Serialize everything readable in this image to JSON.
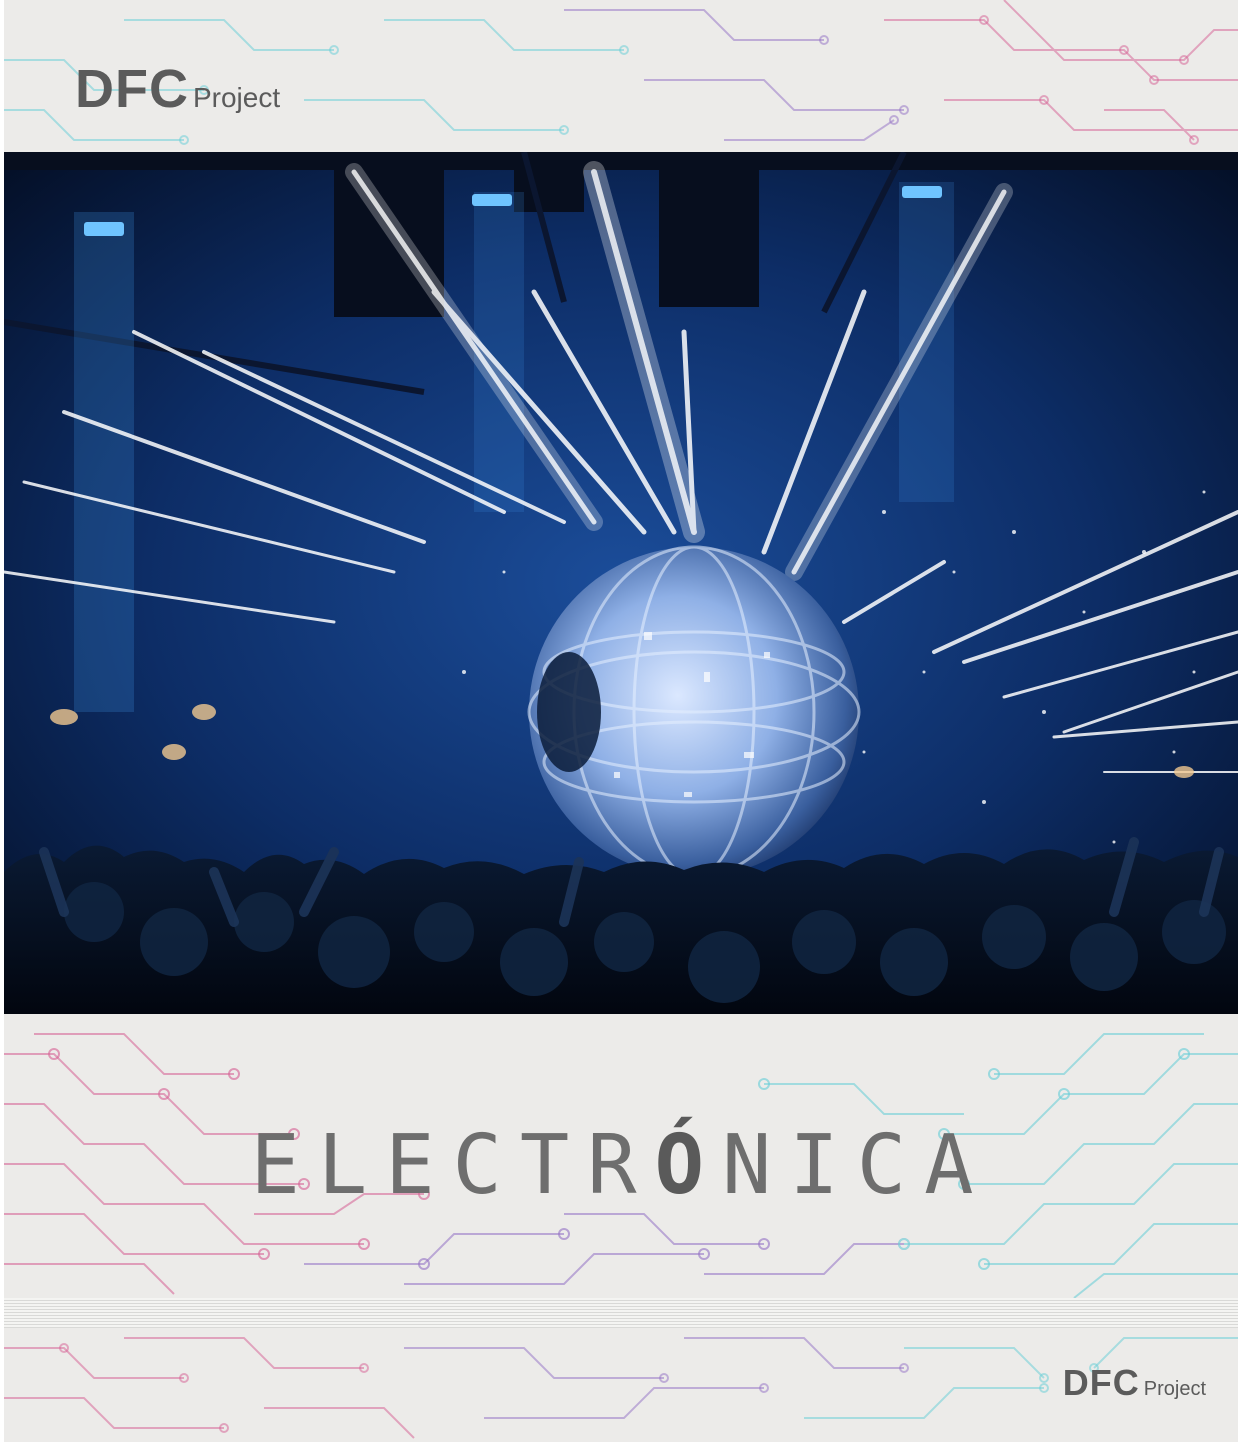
{
  "header": {
    "logo_primary": "DFC",
    "logo_secondary": "Project"
  },
  "title": {
    "before": "ELECTR",
    "accent": "Ó",
    "after": "NICA"
  },
  "footer": {
    "logo_primary": "DFC",
    "logo_secondary": "Project"
  },
  "photo": {
    "subject": "concert-stage-with-led-sphere-and-light-beams"
  },
  "colors": {
    "band_bg": "#ecebe9",
    "logo_text": "#5b5b5b",
    "title_text": "#6e6e6e",
    "circuit_pink": "#d86a9a",
    "circuit_cyan": "#6fd0d8",
    "circuit_purple": "#9a7ac8",
    "photo_deep_blue": "#06183a",
    "photo_blue": "#1a4fa0"
  }
}
